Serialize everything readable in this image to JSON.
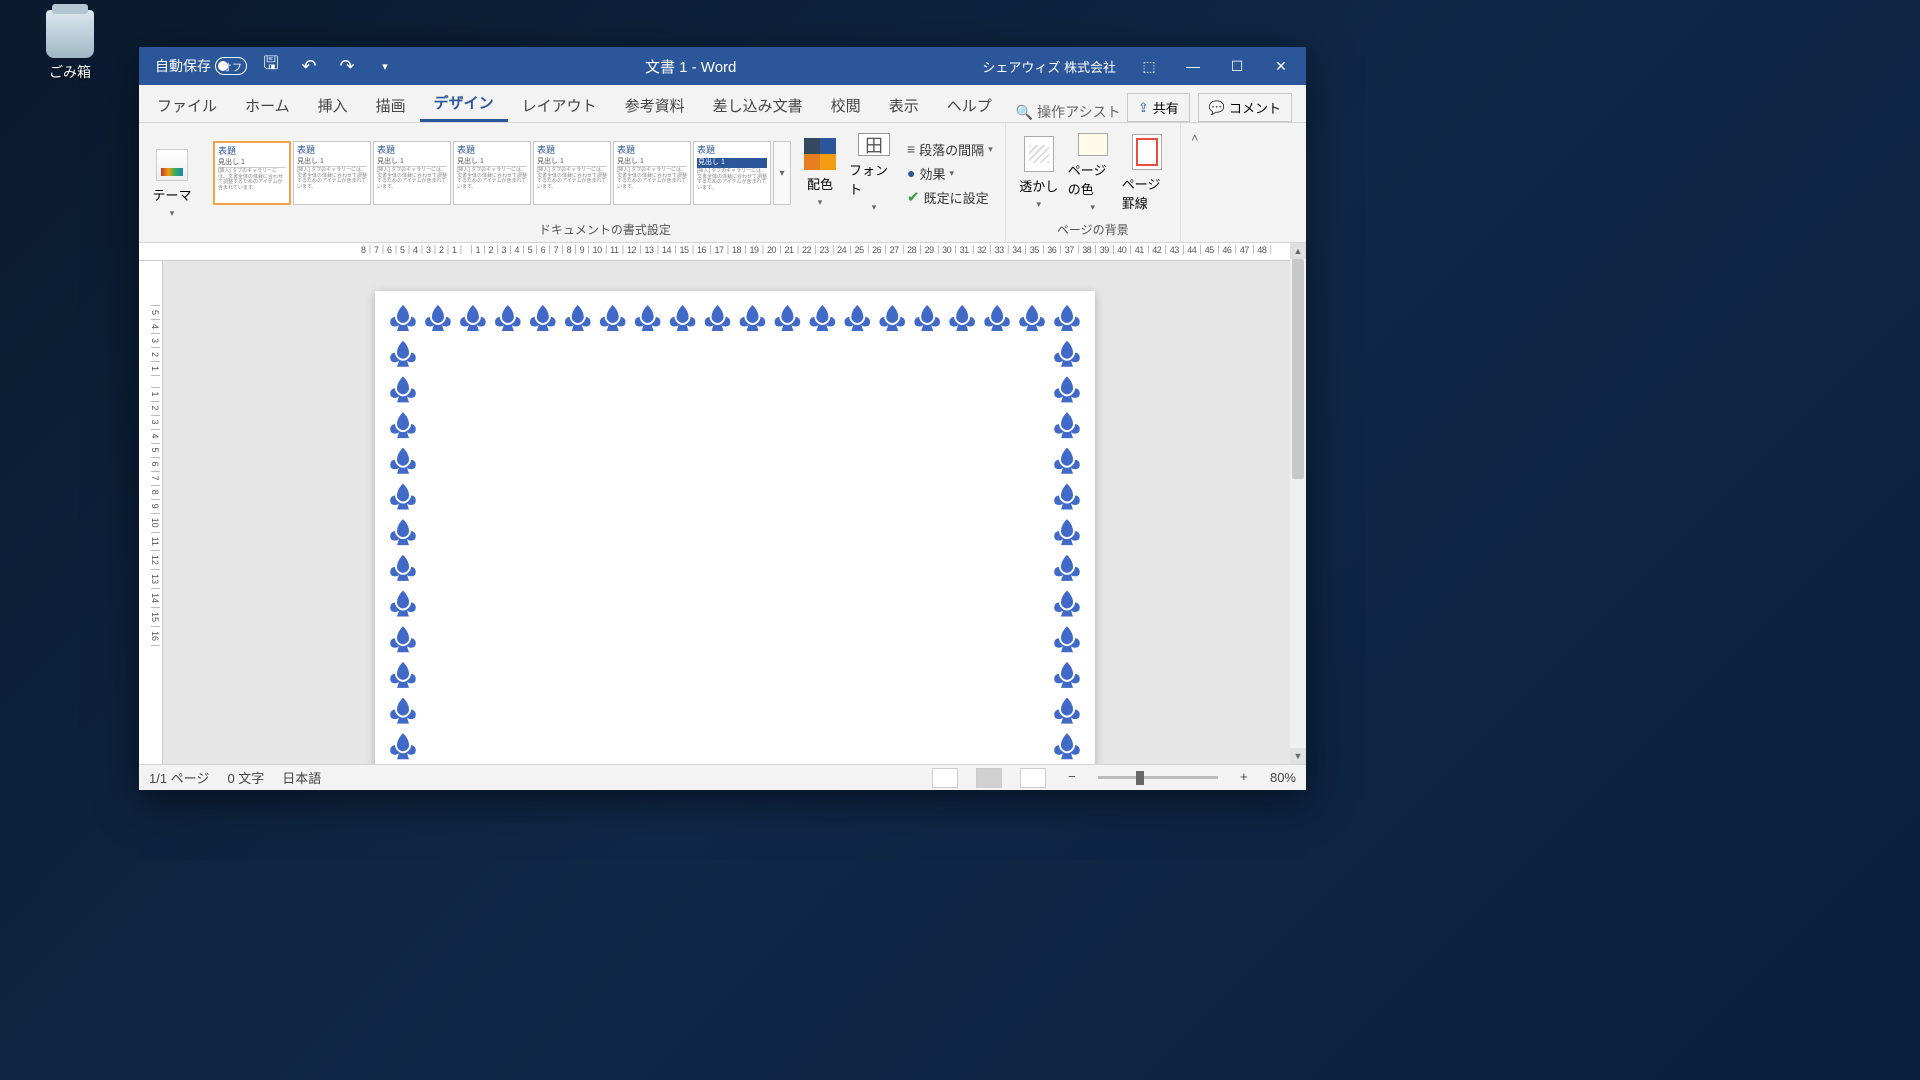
{
  "desktop": {
    "recycle_bin": "ごみ箱"
  },
  "titlebar": {
    "autosave_label": "自動保存",
    "autosave_state": "オフ",
    "doc_title": "文書 1  -  Word",
    "account": "シェアウィズ 株式会社"
  },
  "tabs": {
    "items": [
      "ファイル",
      "ホーム",
      "挿入",
      "描画",
      "デザイン",
      "レイアウト",
      "参考資料",
      "差し込み文書",
      "校閲",
      "表示",
      "ヘルプ"
    ],
    "active_index": 4,
    "tell_me": "操作アシスト",
    "share": "共有",
    "comments": "コメント"
  },
  "ribbon": {
    "themes": "テーマ",
    "doc_format_label": "ドキュメントの書式設定",
    "gallery_title1": "表題",
    "gallery_heading1": "見出し 1",
    "gallery_body": "[挿入] タブのギャラリーには、文書全体の体裁に合わせて調整するためのアイテムが含まれています。",
    "colors": "配色",
    "fonts": "フォント",
    "spacing": "段落の間隔",
    "effects": "効果",
    "set_default": "既定に設定",
    "watermark": "透かし",
    "page_color": "ページの色",
    "page_border": "ページ罫線",
    "page_bg_label": "ページの背景"
  },
  "ruler": {
    "horizontal": "8｜7｜6｜5｜4｜3｜2｜1｜    ｜1｜2｜3｜4｜5｜6｜7｜8｜9｜10｜11｜12｜13｜14｜15｜16｜17｜18｜19｜20｜21｜22｜23｜24｜25｜26｜27｜28｜29｜30｜31｜32｜33｜34｜35｜36｜37｜38｜39｜40｜41｜42｜43｜44｜45｜46｜47｜48｜",
    "vertical": "｜5｜4｜3｜2｜1｜ ｜1｜2｜3｜4｜5｜6｜7｜8｜9｜10｜11｜12｜13｜14｜15｜16｜"
  },
  "status": {
    "page": "1/1 ページ",
    "words": "0 文字",
    "lang": "日本語",
    "zoom": "80%"
  }
}
